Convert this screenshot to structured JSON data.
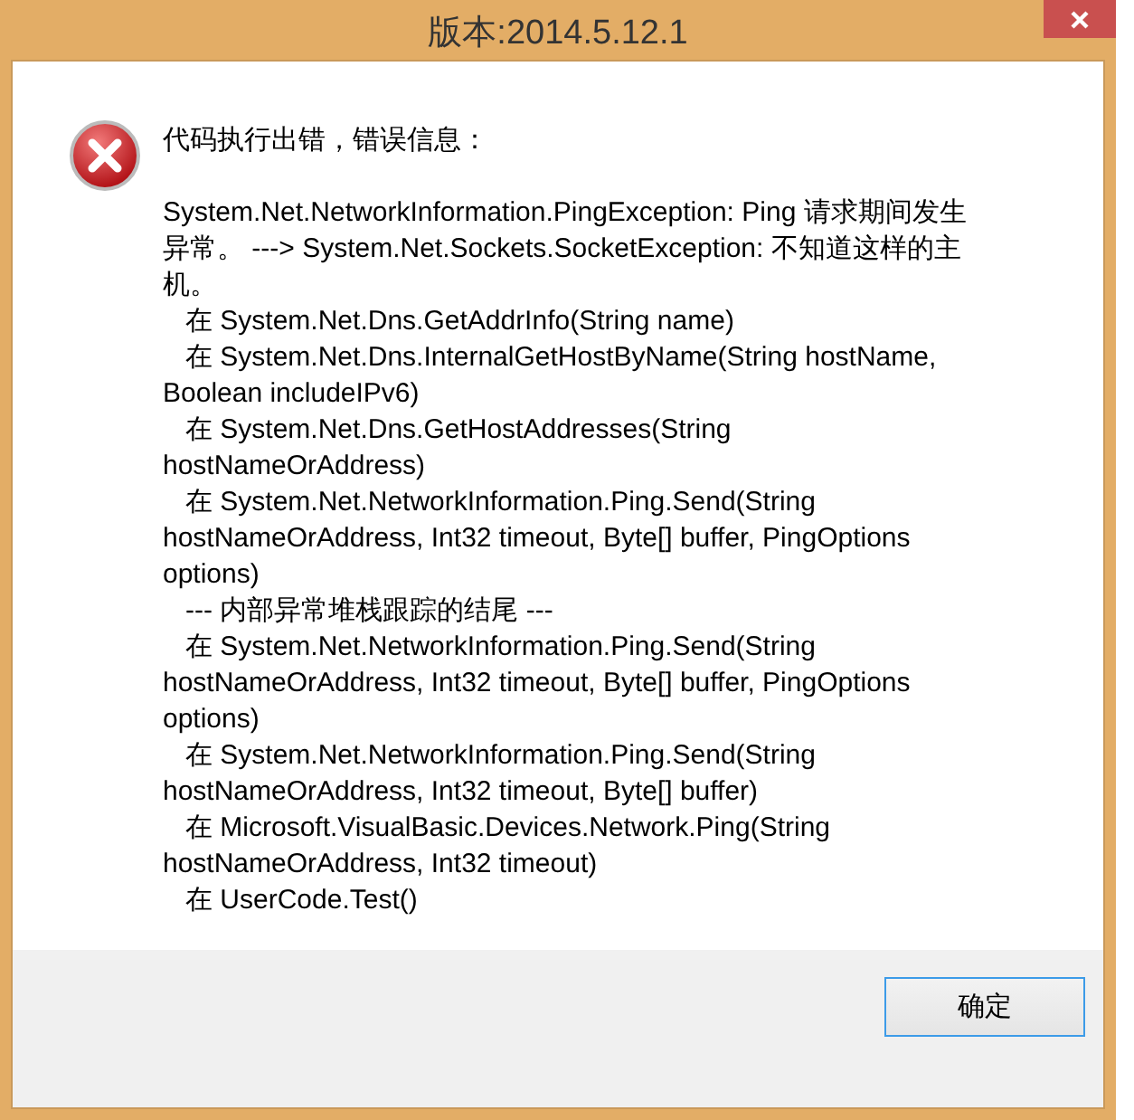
{
  "window": {
    "title": "版本:2014.5.12.1"
  },
  "message": {
    "heading": "代码执行出错，错误信息：",
    "lines": [
      "System.Net.NetworkInformation.PingException: Ping 请求期间发生",
      "异常。 ---> System.Net.Sockets.SocketException: 不知道这样的主",
      "机。",
      "   在 System.Net.Dns.GetAddrInfo(String name)",
      "   在 System.Net.Dns.InternalGetHostByName(String hostName,",
      "Boolean includeIPv6)",
      "   在 System.Net.Dns.GetHostAddresses(String",
      "hostNameOrAddress)",
      "   在 System.Net.NetworkInformation.Ping.Send(String",
      "hostNameOrAddress, Int32 timeout, Byte[] buffer, PingOptions",
      "options)",
      "   --- 内部异常堆栈跟踪的结尾 ---",
      "   在 System.Net.NetworkInformation.Ping.Send(String",
      "hostNameOrAddress, Int32 timeout, Byte[] buffer, PingOptions",
      "options)",
      "   在 System.Net.NetworkInformation.Ping.Send(String",
      "hostNameOrAddress, Int32 timeout, Byte[] buffer)",
      "   在 Microsoft.VisualBasic.Devices.Network.Ping(String",
      "hostNameOrAddress, Int32 timeout)",
      "   在 UserCode.Test()"
    ]
  },
  "buttons": [
    "确定"
  ]
}
